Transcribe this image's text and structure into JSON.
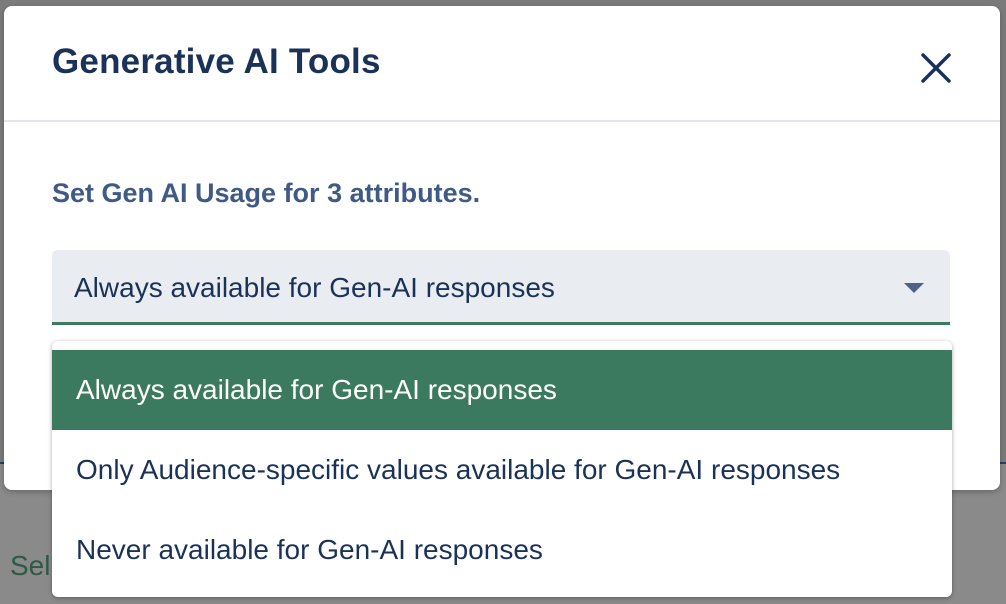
{
  "background": {
    "partial_text": "Sel"
  },
  "dialog": {
    "title": "Generative AI Tools",
    "close_icon": "close-icon",
    "subtitle": "Set Gen AI Usage for 3 attributes.",
    "select": {
      "value": "Always available for Gen-AI responses",
      "arrow_icon": "caret-down-icon"
    },
    "options": [
      {
        "label": "Always available for Gen-AI responses",
        "selected": true
      },
      {
        "label": "Only Audience-specific values available for Gen-AI responses",
        "selected": false
      },
      {
        "label": "Never available for Gen-AI responses",
        "selected": false
      }
    ]
  },
  "colors": {
    "title": "#1b3258",
    "subtitle": "#3f5a85",
    "accent_green": "#3b7a5f",
    "select_bg": "#e9ecf0",
    "overlay": "#7b7b7b"
  }
}
